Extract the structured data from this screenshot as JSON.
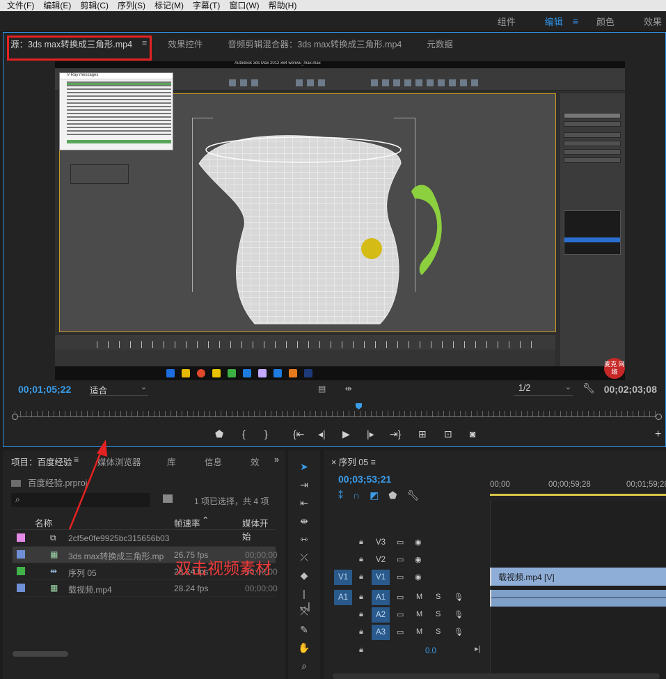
{
  "menu": [
    "文件(F)",
    "编辑(E)",
    "剪辑(C)",
    "序列(S)",
    "标记(M)",
    "字幕(T)",
    "窗口(W)",
    "帮助(H)"
  ],
  "workspaces": {
    "items": [
      "组件",
      "编辑",
      "颜色",
      "效果"
    ],
    "active": "编辑"
  },
  "source_panel": {
    "tabs": [
      "源：3ds max转换成三角形.mp4",
      "效果控件",
      "音频剪辑混合器：3ds max转换成三角形.mp4",
      "元数据"
    ],
    "video_app_title": "Autodesk 3ds Max 2012 x64     wenwu_max.max",
    "vray_title": "V-Ray messages",
    "timecode_in": "00;01;05;22",
    "fit": "适合",
    "resolution": "1/2",
    "timecode_duration": "00;02;03;08",
    "badge": "麦克\n网络"
  },
  "project_panel": {
    "tabs": [
      "项目：百度经验",
      "媒体浏览器",
      "库",
      "信息",
      "效"
    ],
    "file": "百度经验.prproj",
    "search_placeholder": "",
    "selection_info": "1 项已选择，共 4 项",
    "columns": {
      "name": "名称",
      "fps": "帧速率",
      "start": "媒体开始"
    },
    "rows": [
      {
        "name": "2cf5e0fe9925bc315656b03",
        "fps": "",
        "start": "",
        "color": "#e38ae6",
        "icon": "doc"
      },
      {
        "name": "3ds max转换成三角形.mp",
        "fps": "26.75 fps",
        "start": "00;00;00",
        "color": "#6f8fd6",
        "icon": "clip",
        "selected": true
      },
      {
        "name": "序列 05",
        "fps": "28.24 fps",
        "start": "00;00;00",
        "color": "#3fb24a",
        "icon": "seq"
      },
      {
        "name": "载视频.mp4",
        "fps": "28.24 fps",
        "start": "00;00;00",
        "color": "#6f8fd6",
        "icon": "clip"
      }
    ],
    "annotation": "双击视频素材"
  },
  "timeline": {
    "tab": "序列 05",
    "timecode": "00;03;53;21",
    "ruler": [
      "00;00",
      "00;00;59;28",
      "00;01;59;28"
    ],
    "tracks": [
      {
        "name": "V3",
        "target": "",
        "kind": "video"
      },
      {
        "name": "V2",
        "target": "",
        "kind": "video"
      },
      {
        "name": "V1",
        "target": "V1",
        "kind": "video",
        "active": true
      },
      {
        "name": "A1",
        "target": "A1",
        "kind": "audio",
        "active": true
      },
      {
        "name": "A2",
        "target": "",
        "kind": "audio",
        "active": true
      },
      {
        "name": "A3",
        "target": "",
        "kind": "audio",
        "active": true
      }
    ],
    "audio_labels": {
      "mute": "M",
      "solo": "S"
    },
    "clip_v1": "载视频.mp4 [V]",
    "master_volume": "0.0"
  },
  "colors": {
    "accent": "#2f8fe0",
    "highlight_box": "#e52222",
    "annotation": "#ec3a3a"
  }
}
